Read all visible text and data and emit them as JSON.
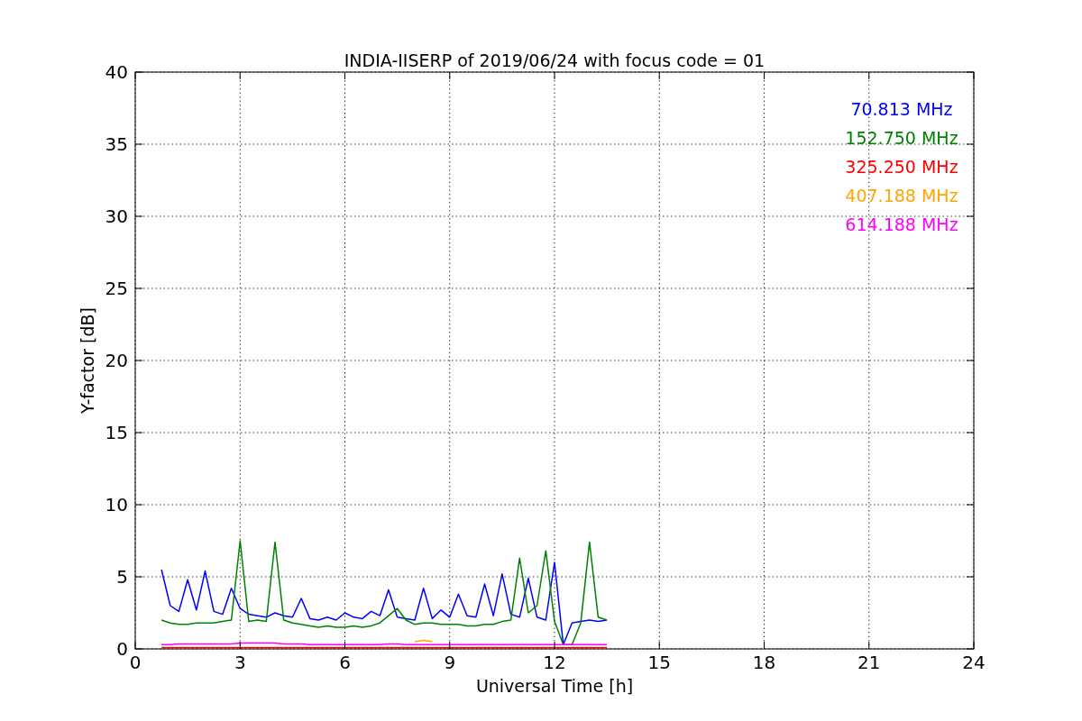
{
  "chart_data": {
    "type": "line",
    "title": "INDIA-IISERP of 2019/06/24 with focus code = 01",
    "xlabel": "Universal Time [h]",
    "ylabel": "Y-factor [dB]",
    "x": [
      0.75,
      1,
      1.25,
      1.5,
      1.75,
      2,
      2.25,
      2.5,
      2.75,
      3,
      3.25,
      3.5,
      3.75,
      4,
      4.25,
      4.5,
      4.75,
      5,
      5.25,
      5.5,
      5.75,
      6,
      6.25,
      6.5,
      6.75,
      7,
      7.25,
      7.5,
      7.75,
      8,
      8.25,
      8.5,
      8.75,
      9,
      9.25,
      9.5,
      9.75,
      10,
      10.25,
      10.5,
      10.75,
      11,
      11.25,
      11.5,
      11.75,
      12,
      12.25,
      12.5,
      12.75,
      13,
      13.25,
      13.5
    ],
    "series": [
      {
        "name": "70.813 MHz",
        "color": "#0000ff",
        "values": [
          5.5,
          3,
          2.6,
          4.8,
          2.7,
          5.4,
          2.6,
          2.4,
          4.2,
          2.8,
          2.4,
          2.3,
          2.2,
          2.5,
          2.3,
          2.2,
          3.5,
          2.1,
          2.0,
          2.2,
          2.0,
          2.5,
          2.2,
          2.1,
          2.6,
          2.3,
          4.1,
          2.2,
          2.1,
          2.0,
          4.2,
          2.1,
          2.7,
          2.2,
          3.8,
          2.3,
          2.2,
          4.5,
          2.3,
          5.2,
          2.4,
          2.2,
          4.9,
          2.2,
          2.0,
          6.0,
          0.3,
          1.8,
          1.9,
          2.0,
          1.9,
          2.0
        ]
      },
      {
        "name": "152.750 MHz",
        "color": "#008000",
        "values": [
          2.0,
          1.8,
          1.7,
          1.7,
          1.8,
          1.8,
          1.8,
          1.9,
          2.0,
          7.5,
          1.9,
          2.0,
          1.9,
          7.4,
          2.0,
          1.8,
          1.7,
          1.6,
          1.5,
          1.6,
          1.5,
          1.5,
          1.6,
          1.5,
          1.6,
          1.8,
          2.3,
          2.8,
          2.0,
          1.7,
          1.8,
          1.8,
          1.7,
          1.7,
          1.7,
          1.6,
          1.6,
          1.7,
          1.7,
          1.9,
          2.0,
          6.3,
          2.5,
          3.0,
          6.8,
          1.9,
          0.3,
          0.3,
          1.8,
          7.4,
          2.2,
          2.0
        ]
      },
      {
        "name": "325.250 MHz",
        "color": "#ff0000",
        "values": [
          0.1,
          0.1,
          0.1,
          0.1,
          0.1,
          0.1,
          0.1,
          0.1,
          0.1,
          0.1,
          0.1,
          0.1,
          0.1,
          0.1,
          0.1,
          0.1,
          0.1,
          0.1,
          0.1,
          0.1,
          0.1,
          0.1,
          0.1,
          0.1,
          0.1,
          0.1,
          0.1,
          0.1,
          0.1,
          0.1,
          0.1,
          0.1,
          0.1,
          0.1,
          0.1,
          0.1,
          0.1,
          0.1,
          0.1,
          0.1,
          0.1,
          0.1,
          0.1,
          0.1,
          0.1,
          0.1,
          0.1,
          0.1,
          0.1,
          0.1,
          0.1,
          0.1
        ]
      },
      {
        "name": "407.188 MHz",
        "color": "#ffa500",
        "values": [
          null,
          null,
          null,
          null,
          null,
          null,
          null,
          null,
          null,
          null,
          null,
          null,
          null,
          null,
          null,
          null,
          null,
          null,
          null,
          null,
          null,
          null,
          null,
          null,
          null,
          null,
          null,
          null,
          null,
          0.5,
          0.6,
          0.5,
          null,
          null,
          null,
          null,
          null,
          null,
          null,
          null,
          null,
          null,
          null,
          null,
          null,
          null,
          null,
          null,
          null,
          null,
          null,
          null
        ]
      },
      {
        "name": "614.188 MHz",
        "color": "#ff00ff",
        "values": [
          0.3,
          0.3,
          0.35,
          0.35,
          0.35,
          0.35,
          0.35,
          0.35,
          0.35,
          0.4,
          0.4,
          0.4,
          0.4,
          0.4,
          0.35,
          0.35,
          0.35,
          0.3,
          0.3,
          0.3,
          0.3,
          0.3,
          0.3,
          0.3,
          0.3,
          0.3,
          0.35,
          0.35,
          0.3,
          0.3,
          0.3,
          0.3,
          0.3,
          0.3,
          0.3,
          0.3,
          0.3,
          0.3,
          0.3,
          0.3,
          0.3,
          0.3,
          0.3,
          0.3,
          0.3,
          0.3,
          0.3,
          0.3,
          0.3,
          0.3,
          0.3,
          0.3
        ]
      }
    ],
    "grid": true,
    "xlim": [
      0,
      24
    ],
    "ylim": [
      0,
      40
    ],
    "xticks": [
      0,
      3,
      6,
      9,
      12,
      15,
      18,
      21,
      24
    ],
    "yticks": [
      0,
      5,
      10,
      15,
      20,
      25,
      30,
      35,
      40
    ]
  }
}
